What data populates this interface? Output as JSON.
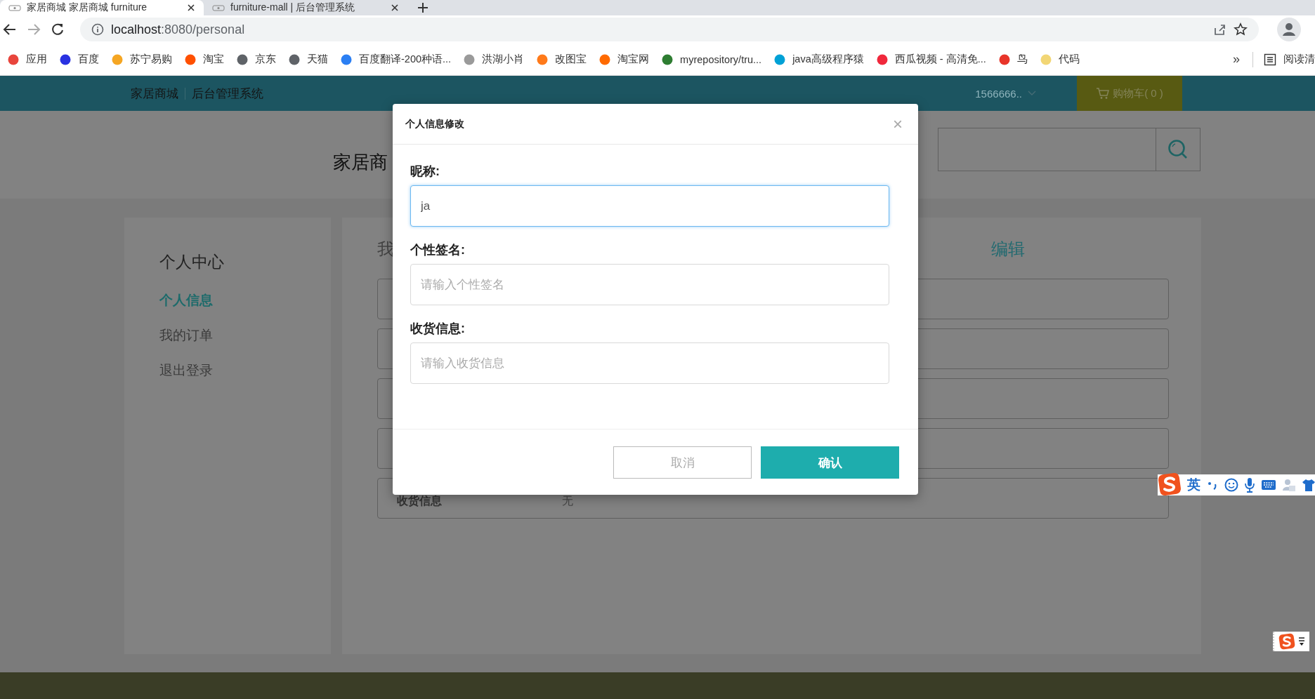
{
  "browser": {
    "tabs": [
      {
        "title": "家居商城 家居商城 furniture",
        "selected": true
      },
      {
        "title": "furniture-mall | 后台管理系统",
        "selected": false
      }
    ],
    "address": {
      "host": "localhost",
      "path": ":8080/personal"
    },
    "bookmarks": [
      {
        "label": "应用",
        "color": "#e8453c"
      },
      {
        "label": "百度",
        "color": "#2932e1"
      },
      {
        "label": "苏宁易购",
        "color": "#f5a623"
      },
      {
        "label": "淘宝",
        "color": "#ff5000"
      },
      {
        "label": "京东",
        "color": "#5f6368"
      },
      {
        "label": "天猫",
        "color": "#5f6368"
      },
      {
        "label": "百度翻译-200种语...",
        "color": "#2b7ff3"
      },
      {
        "label": "洪湖小肖",
        "color": "#9a9a9a"
      },
      {
        "label": "改图宝",
        "color": "#ff7a1a"
      },
      {
        "label": "淘宝网",
        "color": "#ff6a00"
      },
      {
        "label": "myrepository/tru...",
        "color": "#2e7d32"
      },
      {
        "label": "java高级程序猿",
        "color": "#00a1d6"
      },
      {
        "label": "西瓜视频 - 高清免...",
        "color": "#f0283c"
      },
      {
        "label": "鸟",
        "color": "#e8352a"
      },
      {
        "label": "代码",
        "color": "#f2d675"
      }
    ],
    "overflow": "»",
    "reading_list": "阅读清"
  },
  "site": {
    "nav": [
      "家居商城",
      "后台管理系统"
    ],
    "user": "1566666..",
    "cart": "购物车( 0 )",
    "logo_text": "家居商",
    "sidebar": {
      "title": "个人中心",
      "items": [
        {
          "label": "个人信息",
          "selected": true
        },
        {
          "label": "我的订单",
          "selected": false
        },
        {
          "label": "退出登录",
          "selected": false
        }
      ]
    },
    "main": {
      "title": "我",
      "edit": "编辑",
      "rows": [
        {
          "kind": "covered"
        },
        {
          "kind": "covered"
        },
        {
          "kind": "covered"
        },
        {
          "kind": "covered"
        },
        {
          "kind": "field",
          "label": "收货信息",
          "value": "无"
        }
      ]
    }
  },
  "dialog": {
    "title": "个人信息修改",
    "close": "×",
    "fields": [
      {
        "label": "昵称:",
        "value": "ja",
        "focused": true
      },
      {
        "label": "个性签名:",
        "placeholder": "请输入个性签名",
        "focused": false
      },
      {
        "label": "收货信息:",
        "placeholder": "请输入收货信息",
        "focused": false
      }
    ],
    "buttons": [
      {
        "label": "取消",
        "kind": "secondary"
      },
      {
        "label": "确认",
        "kind": "primary"
      }
    ]
  },
  "ime": {
    "mode": "英"
  }
}
